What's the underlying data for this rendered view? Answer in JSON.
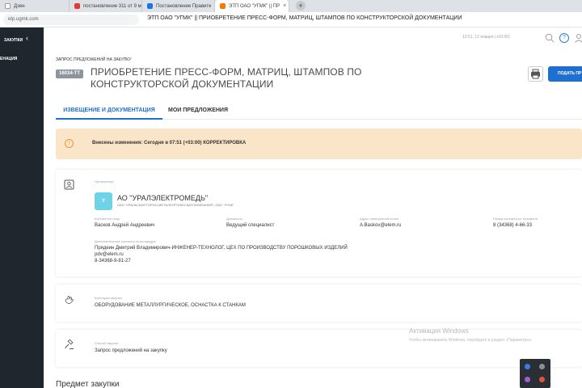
{
  "browser": {
    "tabs": [
      {
        "label": "Дзен",
        "favicon_color": "#ffffff",
        "active": false
      },
      {
        "label": "постановление 311 от 9 м",
        "favicon_color": "#e53935",
        "active": false
      },
      {
        "label": "Постановление Правите",
        "favicon_color": "#1a73e8",
        "active": false
      },
      {
        "label": "ЭТП ОАО \"УГМК\" || ПР",
        "favicon_color": "#f57c00",
        "active": true
      }
    ],
    "close_glyph": "×",
    "new_tab_glyph": "+",
    "url": "etp.ugmk.com",
    "window_title": "ЭТП ОАО \"УГМК\" || ПРИОБРЕТЕНИЕ ПРЕСС-ФОРМ, МАТРИЦ, ШТАМПОВ ПО КОНСТРУКТОРСКОЙ ДОКУМЕНТАЦИИ"
  },
  "sidebar": {
    "header": "ЗАКУПКИ",
    "collapse_glyph": "‹",
    "item": "ЕНАЦИЯ"
  },
  "header": {
    "datetime": "13:51, 12 января (+03:00)",
    "help_glyph": "?"
  },
  "page": {
    "breadcrumb": "ЗАПРОС ПРЕДЛОЖЕНИЙ НА ЗАКУПКУ",
    "id_badge": "16034-ТТ",
    "title": "ПРИОБРЕТЕНИЕ ПРЕСС-ФОРМ, МАТРИЦ, ШТАМПОВ ПО КОНСТРУКТОРСКОЙ ДОКУМЕНТАЦИИ",
    "submit_label": "ПОДАТЬ ПР",
    "tabs": [
      {
        "label": "ИЗВЕЩЕНИЕ И ДОКУМЕНТАЦИЯ",
        "active": true
      },
      {
        "label": "МОИ ПРЕДЛОЖЕНИЯ",
        "active": false
      }
    ]
  },
  "notice": {
    "icon_glyph": "!",
    "text": "Внесены изменения: Сегодня в 07:51 (+03:00) КОРРЕКТИРОВКА"
  },
  "organizer": {
    "label": "Организатор",
    "logo_letter": "У",
    "name": "АО \"УРАЛЭЛЕКТРОМЕДЬ\"",
    "subname": "ОАО \"УРАЛЬСКАЯ ГОРНО-МЕТАЛЛУРГИЧЕСКАЯ КОМПАНИЯ\", ОАО \"УГМК\"",
    "fields": [
      {
        "label": "Контактное лицо",
        "value": "Васков Андрей Андреевич"
      },
      {
        "label": "Должность",
        "value": "Ведущий специалист"
      },
      {
        "label": "Адрес электронной почты",
        "value": "A.Baskov@elem.ru"
      },
      {
        "label": "Номер контактного телефона",
        "value": "8 (34368) 4-66-33"
      }
    ],
    "extra_label": "Дополнительные контакты по процедуре",
    "extra_lines": [
      "Прядеин Дмитрий Владимирович-ИНЖЕНЕР-ТЕХНОЛОГ, ЦЕХ ПО ПРОИЗВОДСТВУ ПОРОШКОВЫХ ИЗДЕЛИЙ",
      "pdv@elem.ru",
      "8-34368-9-81-27"
    ]
  },
  "category": {
    "label": "Категория закупки",
    "value": "ОБОРУДОВАНИЕ МЕТАЛЛУРГИЧЕСКОЕ, ОСНАСТКА К СТАНКАМ"
  },
  "method": {
    "label": "Способ закупки",
    "value": "Запрос предложений на закупку"
  },
  "section_title": "Предмет закупки",
  "watermark": {
    "line1": "Активация Windows",
    "line2": "Чтобы активировать Windows, перейдите в раздел «Параметры»."
  },
  "colors": {
    "accent": "#1f6fd1",
    "sidebar": "#1f262e",
    "notice_bg": "#fbe5c8",
    "notice_icon": "#e89a3c"
  }
}
